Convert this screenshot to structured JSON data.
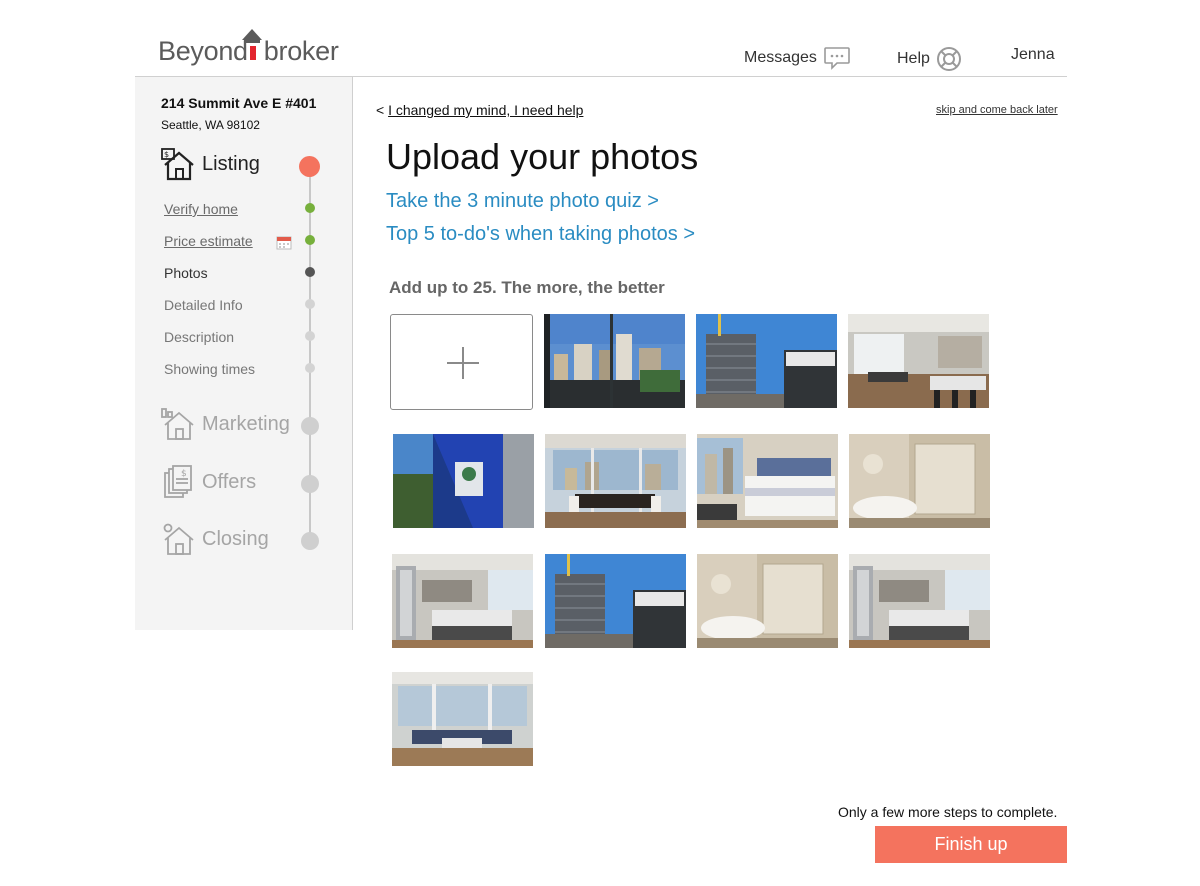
{
  "header": {
    "logo_left": "Beyond",
    "logo_right": "broker",
    "nav": {
      "messages": "Messages",
      "help": "Help",
      "user": "Jenna"
    }
  },
  "sidebar": {
    "address_line1": "214 Summit Ave E #401",
    "address_line2": "Seattle, WA 98102",
    "steps": [
      {
        "label": "Listing",
        "icon": "house-listing-icon",
        "state": "active"
      },
      {
        "label": "Marketing",
        "icon": "house-chart-icon",
        "state": "upcoming"
      },
      {
        "label": "Offers",
        "icon": "documents-dollar-icon",
        "state": "upcoming"
      },
      {
        "label": "Closing",
        "icon": "house-gear-icon",
        "state": "upcoming"
      }
    ],
    "substeps": [
      {
        "label": "Verify home",
        "state": "done"
      },
      {
        "label": "Price estimate",
        "state": "done"
      },
      {
        "label": "Photos",
        "state": "current"
      },
      {
        "label": "Detailed Info",
        "state": "pending"
      },
      {
        "label": "Description",
        "state": "pending"
      },
      {
        "label": "Showing times",
        "state": "pending"
      }
    ]
  },
  "main": {
    "back_prefix": "<",
    "back_link": "I changed my mind, I need help",
    "skip_link": "skip and come back later",
    "title": "Upload your photos",
    "tips": [
      "Take the 3 minute photo quiz >",
      "Top 5 to-do's when taking photos >"
    ],
    "grid_heading": "Add up to 25. The more, the better",
    "photos": [
      "balcony-skyline",
      "tower-crane",
      "open-kitchen-living",
      "blue-glass-facade",
      "dining-window",
      "bedroom",
      "bathroom-tub",
      "kitchen-island",
      "tower-crane",
      "bathroom-tub",
      "kitchen-island",
      "living-room"
    ]
  },
  "footer": {
    "note": "Only a few more steps to complete.",
    "finish_button": "Finish up"
  },
  "colors": {
    "accent": "#f4735e",
    "link_blue": "#2a8cc2",
    "done_green": "#77b03c",
    "sidebar_bg": "#f4f4f4"
  }
}
